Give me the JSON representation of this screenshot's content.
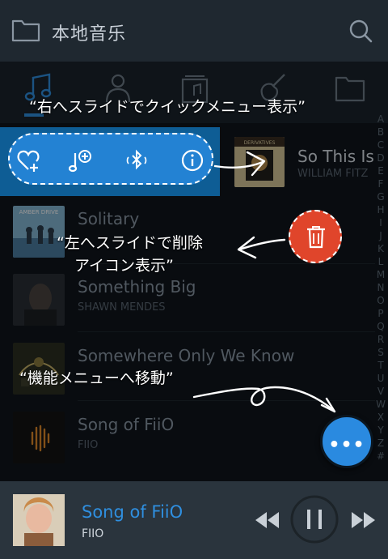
{
  "header": {
    "title": "本地音乐",
    "folder_icon": "folder-icon",
    "search_icon": "search-icon"
  },
  "tabs": [
    {
      "icon": "music-note-icon",
      "active": true
    },
    {
      "icon": "artist-icon",
      "active": false
    },
    {
      "icon": "album-icon",
      "active": false
    },
    {
      "icon": "guitar-icon",
      "active": false
    },
    {
      "icon": "folder-icon",
      "active": false
    }
  ],
  "index_letters": [
    "A",
    "B",
    "C",
    "D",
    "E",
    "F",
    "G",
    "H",
    "I",
    "J",
    "K",
    "L",
    "M",
    "N",
    "O",
    "P",
    "Q",
    "R",
    "S",
    "T",
    "U",
    "V",
    "W",
    "X",
    "Y",
    "Z",
    "#"
  ],
  "songs": [
    {
      "title": "So This Is",
      "artist": "WILLIAM FITZ"
    },
    {
      "title": "Solitary",
      "artist": ""
    },
    {
      "title": "Something Big",
      "artist": "SHAWN MENDES"
    },
    {
      "title": "Somewhere Only We Know",
      "artist": ""
    },
    {
      "title": "Song of FiiO",
      "artist": "FIIO"
    }
  ],
  "album_labels": {
    "album1": "DERIVATIVES",
    "album2": "AMBER DRIVE"
  },
  "quick_menu_icons": [
    "heart-plus-icon",
    "add-to-playlist-icon",
    "bluetooth-icon",
    "info-icon"
  ],
  "annotations": {
    "right_swipe": "“右へスライドでクイックメニュー表示”",
    "left_swipe_line1": "“左へスライドで削除",
    "left_swipe_line2": "アイコン表示”",
    "menu_move": "“機能メニューへ移動”"
  },
  "menu_fab": {
    "label": "•••",
    "icon": "more-dots-icon"
  },
  "delete_icon": "trash-icon",
  "player": {
    "title": "Song of FiiO",
    "artist": "FIIO",
    "state": "playing"
  },
  "colors": {
    "accent": "#2f8fe0",
    "delete": "#e0452b",
    "quick_panel": "#0e5d95"
  }
}
